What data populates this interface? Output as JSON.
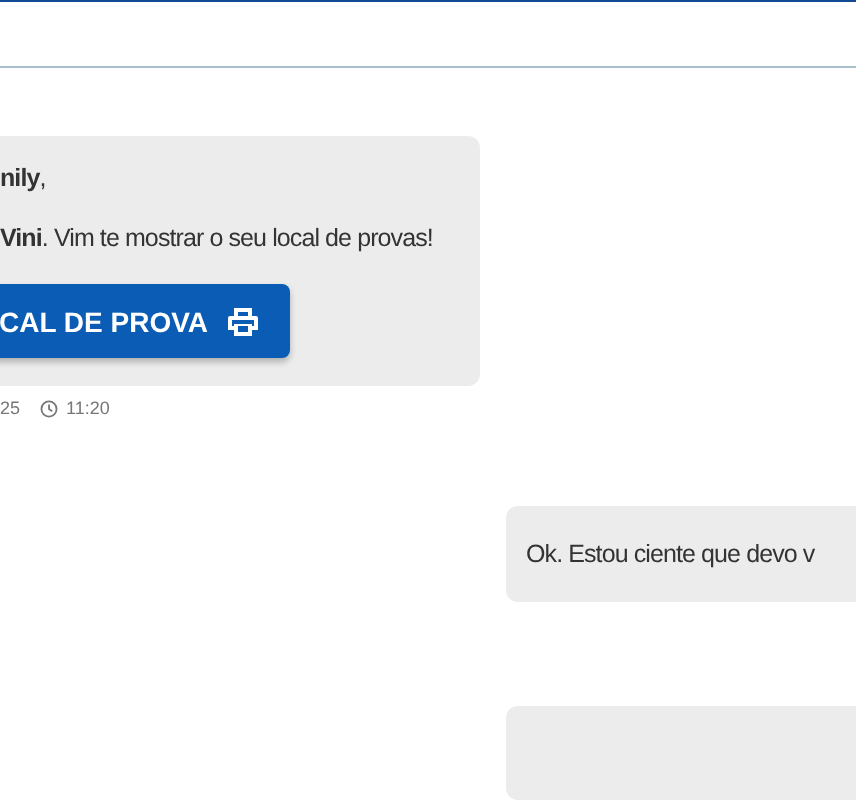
{
  "messages": [
    {
      "kind": "received",
      "greeting": "**nily**,",
      "text": "**Vini**. Vim te mostrar o seu local de provas!",
      "button": "CAL DE PROVA",
      "date": "25",
      "time": "11:20"
    },
    {
      "kind": "sent",
      "text": "Ok. Estou ciente que devo v"
    },
    {
      "kind": "sent"
    }
  ]
}
